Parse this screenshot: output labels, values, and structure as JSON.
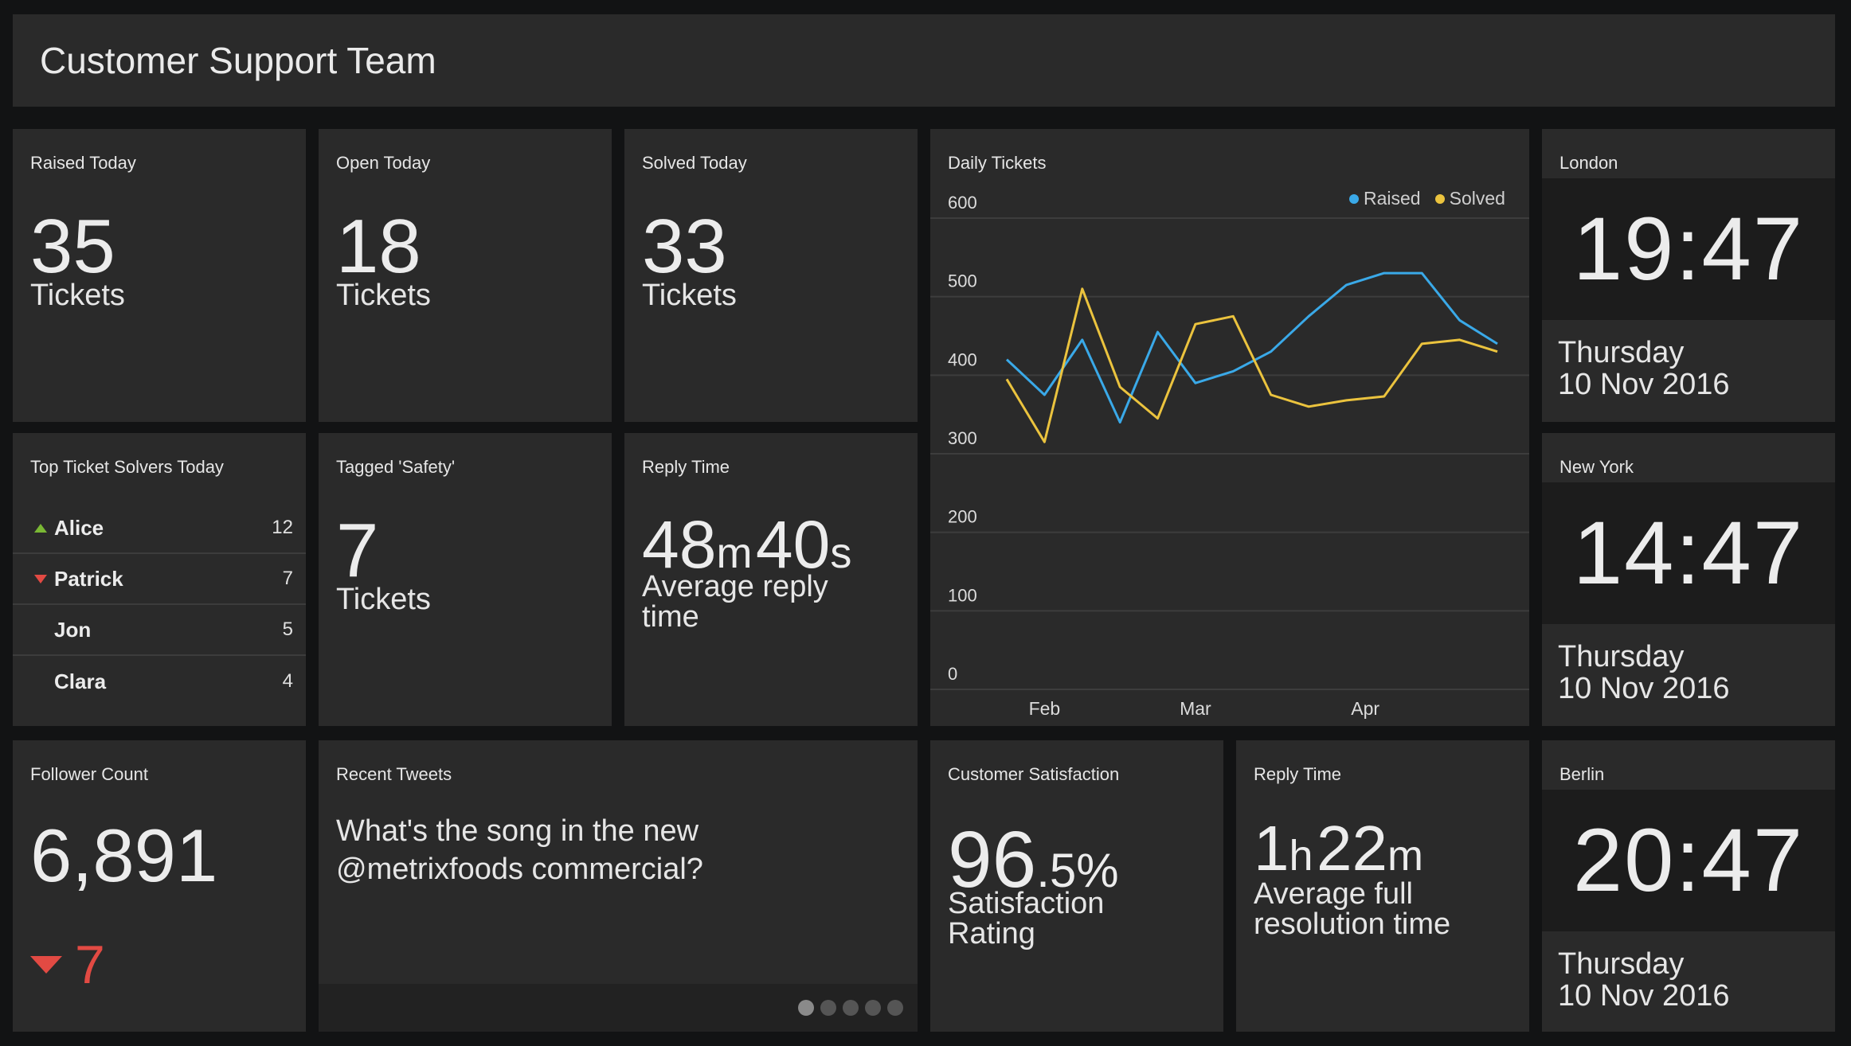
{
  "header": {
    "title": "Customer Support Team"
  },
  "colors": {
    "raised": "#3aa9e8",
    "solved": "#ebc33e",
    "up": "#7ab834",
    "down": "#e24a43"
  },
  "raised_today": {
    "title": "Raised Today",
    "value": "35",
    "unit": "Tickets"
  },
  "open_today": {
    "title": "Open Today",
    "value": "18",
    "unit": "Tickets"
  },
  "solved_today": {
    "title": "Solved Today",
    "value": "33",
    "unit": "Tickets"
  },
  "top_solvers": {
    "title": "Top Ticket Solvers Today",
    "rows": [
      {
        "name": "Alice",
        "count": "12",
        "trend": "up"
      },
      {
        "name": "Patrick",
        "count": "7",
        "trend": "down"
      },
      {
        "name": "Jon",
        "count": "5",
        "trend": "none"
      },
      {
        "name": "Clara",
        "count": "4",
        "trend": "none"
      }
    ]
  },
  "tagged_safety": {
    "title": "Tagged 'Safety'",
    "value": "7",
    "unit": "Tickets"
  },
  "reply_time": {
    "title": "Reply Time",
    "minutes": "48",
    "m": "m",
    "seconds": "40",
    "s": "s",
    "label_line1": "Average reply",
    "label_line2": "time"
  },
  "clocks": [
    {
      "city": "London",
      "time": "19:47",
      "day": "Thursday",
      "date": "10 Nov 2016"
    },
    {
      "city": "New York",
      "time": "14:47",
      "day": "Thursday",
      "date": "10 Nov 2016"
    },
    {
      "city": "Berlin",
      "time": "20:47",
      "day": "Thursday",
      "date": "10 Nov 2016"
    }
  ],
  "follower_count": {
    "title": "Follower Count",
    "value": "6,891",
    "change": "7",
    "change_direction": "down"
  },
  "recent_tweets": {
    "title": "Recent Tweets",
    "text_line1": "What's the song in the new",
    "text_line2": "@metrixfoods commercial?",
    "pages": 5,
    "active_page": 1
  },
  "satisfaction": {
    "title": "Customer Satisfaction",
    "int": "96",
    "frac": ".5%",
    "label_line1": "Satisfaction",
    "label_line2": "Rating"
  },
  "resolution_time": {
    "title": "Reply Time",
    "hours": "1",
    "h": "h",
    "minutes": "22",
    "m": "m",
    "label_line1": "Average full",
    "label_line2": "resolution time"
  },
  "chart_data": {
    "type": "line",
    "title": "Daily Tickets",
    "ylim": [
      0,
      600
    ],
    "yticks": [
      "0",
      "100",
      "200",
      "300",
      "400",
      "500",
      "600"
    ],
    "xticks": [
      "Feb",
      "Mar",
      "Apr"
    ],
    "x_tick_index": [
      1,
      5,
      9.5
    ],
    "legend_position": "top-right",
    "grid": true,
    "series": [
      {
        "name": "Raised",
        "color": "#3aa9e8",
        "values": [
          420,
          375,
          445,
          340,
          455,
          390,
          405,
          430,
          475,
          515,
          530,
          530,
          470,
          440
        ]
      },
      {
        "name": "Solved",
        "color": "#ebc33e",
        "values": [
          395,
          315,
          510,
          385,
          345,
          465,
          475,
          375,
          360,
          368,
          373,
          440,
          445,
          430
        ]
      }
    ]
  }
}
